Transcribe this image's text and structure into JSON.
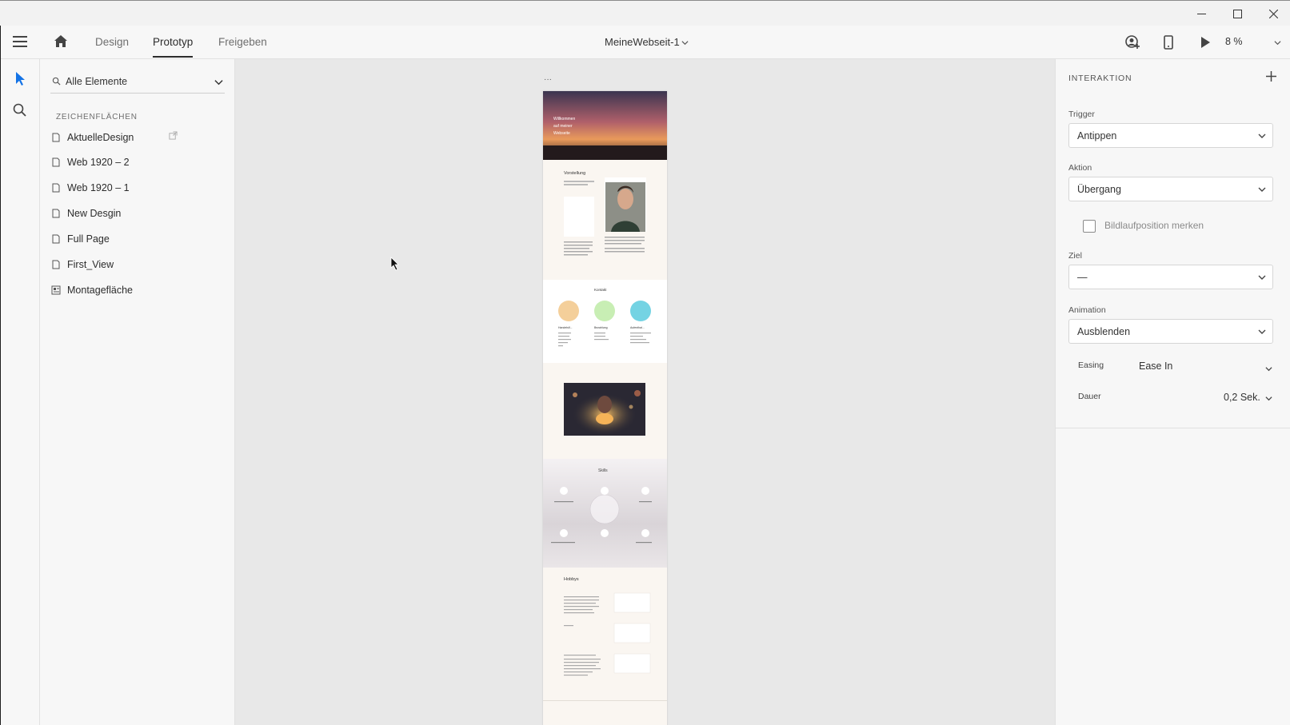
{
  "window": {
    "minimize": "—",
    "maximize": "☐",
    "close": "✕"
  },
  "topbar": {
    "tabs": [
      {
        "label": "Design",
        "active": false
      },
      {
        "label": "Prototyp",
        "active": true
      },
      {
        "label": "Freigeben",
        "active": false
      }
    ],
    "document_title": "MeineWebseit-1",
    "zoom": "8 %"
  },
  "layers": {
    "search_label": "Alle Elemente",
    "section_label": "ZEICHENFLÄCHEN",
    "items": [
      {
        "label": "AktuelleDesign",
        "icon": "artboard-icon"
      },
      {
        "label": "Web 1920 – 2",
        "icon": "artboard-icon"
      },
      {
        "label": "Web 1920 – 1",
        "icon": "artboard-icon"
      },
      {
        "label": "New Desgin",
        "icon": "artboard-icon"
      },
      {
        "label": "Full Page",
        "icon": "artboard-icon"
      },
      {
        "label": "First_View",
        "icon": "artboard-icon"
      },
      {
        "label": "Montagefläche",
        "icon": "pasteboard-icon"
      }
    ]
  },
  "artboard": {
    "header_text_1": "Willkommen",
    "header_text_2": "auf meiner",
    "header_text_3": "Webseite",
    "section_vorstellung": "Vorstellung",
    "section_kontakt": "Kontakt",
    "contact_col_1": "Handelsfl...",
    "contact_col_2": "Bezahlung",
    "contact_col_3": "Aufenthal...",
    "section_skills": "Skills",
    "section_hobbys": "Hobbys",
    "colors": {
      "circle_1": "#f4cf9a",
      "circle_2": "#c8eeb4",
      "circle_3": "#74d3e3",
      "page_bg": "#faf6f1"
    }
  },
  "props": {
    "heading": "INTERAKTION",
    "trigger_label": "Trigger",
    "trigger_value": "Antippen",
    "action_label": "Aktion",
    "action_value": "Übergang",
    "scroll_checkbox_label": "Bildlaufposition merken",
    "target_label": "Ziel",
    "target_value": "—",
    "animation_label": "Animation",
    "animation_value": "Ausblenden",
    "easing_label": "Easing",
    "easing_value": "Ease In",
    "duration_label": "Dauer",
    "duration_value": "0,2 Sek."
  },
  "accent": "#1473e6"
}
